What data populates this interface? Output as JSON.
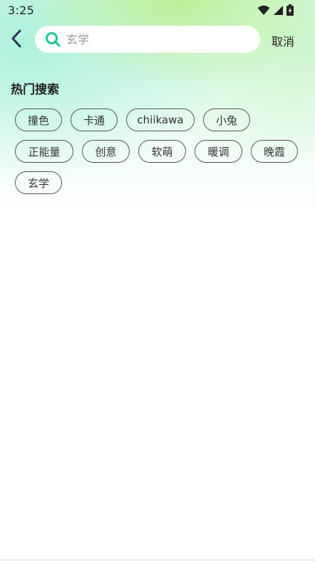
{
  "status_bar": {
    "time": "3:25",
    "icons": [
      "wifi-icon",
      "signal-icon",
      "battery-charging-icon"
    ]
  },
  "header": {
    "back_icon": "chevron-left-icon",
    "search": {
      "icon": "search-icon",
      "value": "",
      "placeholder": "玄学"
    },
    "cancel_label": "取消"
  },
  "hot_search": {
    "title": "热门搜索",
    "tags": [
      "撞色",
      "卡通",
      "chiikawa",
      "小兔",
      "正能量",
      "创意",
      "软萌",
      "暖调",
      "晚霞",
      "玄学"
    ]
  },
  "colors": {
    "accent": "#1fc49a",
    "text": "#222222",
    "tag_border": "#555555",
    "placeholder": "#9a9a9a"
  }
}
